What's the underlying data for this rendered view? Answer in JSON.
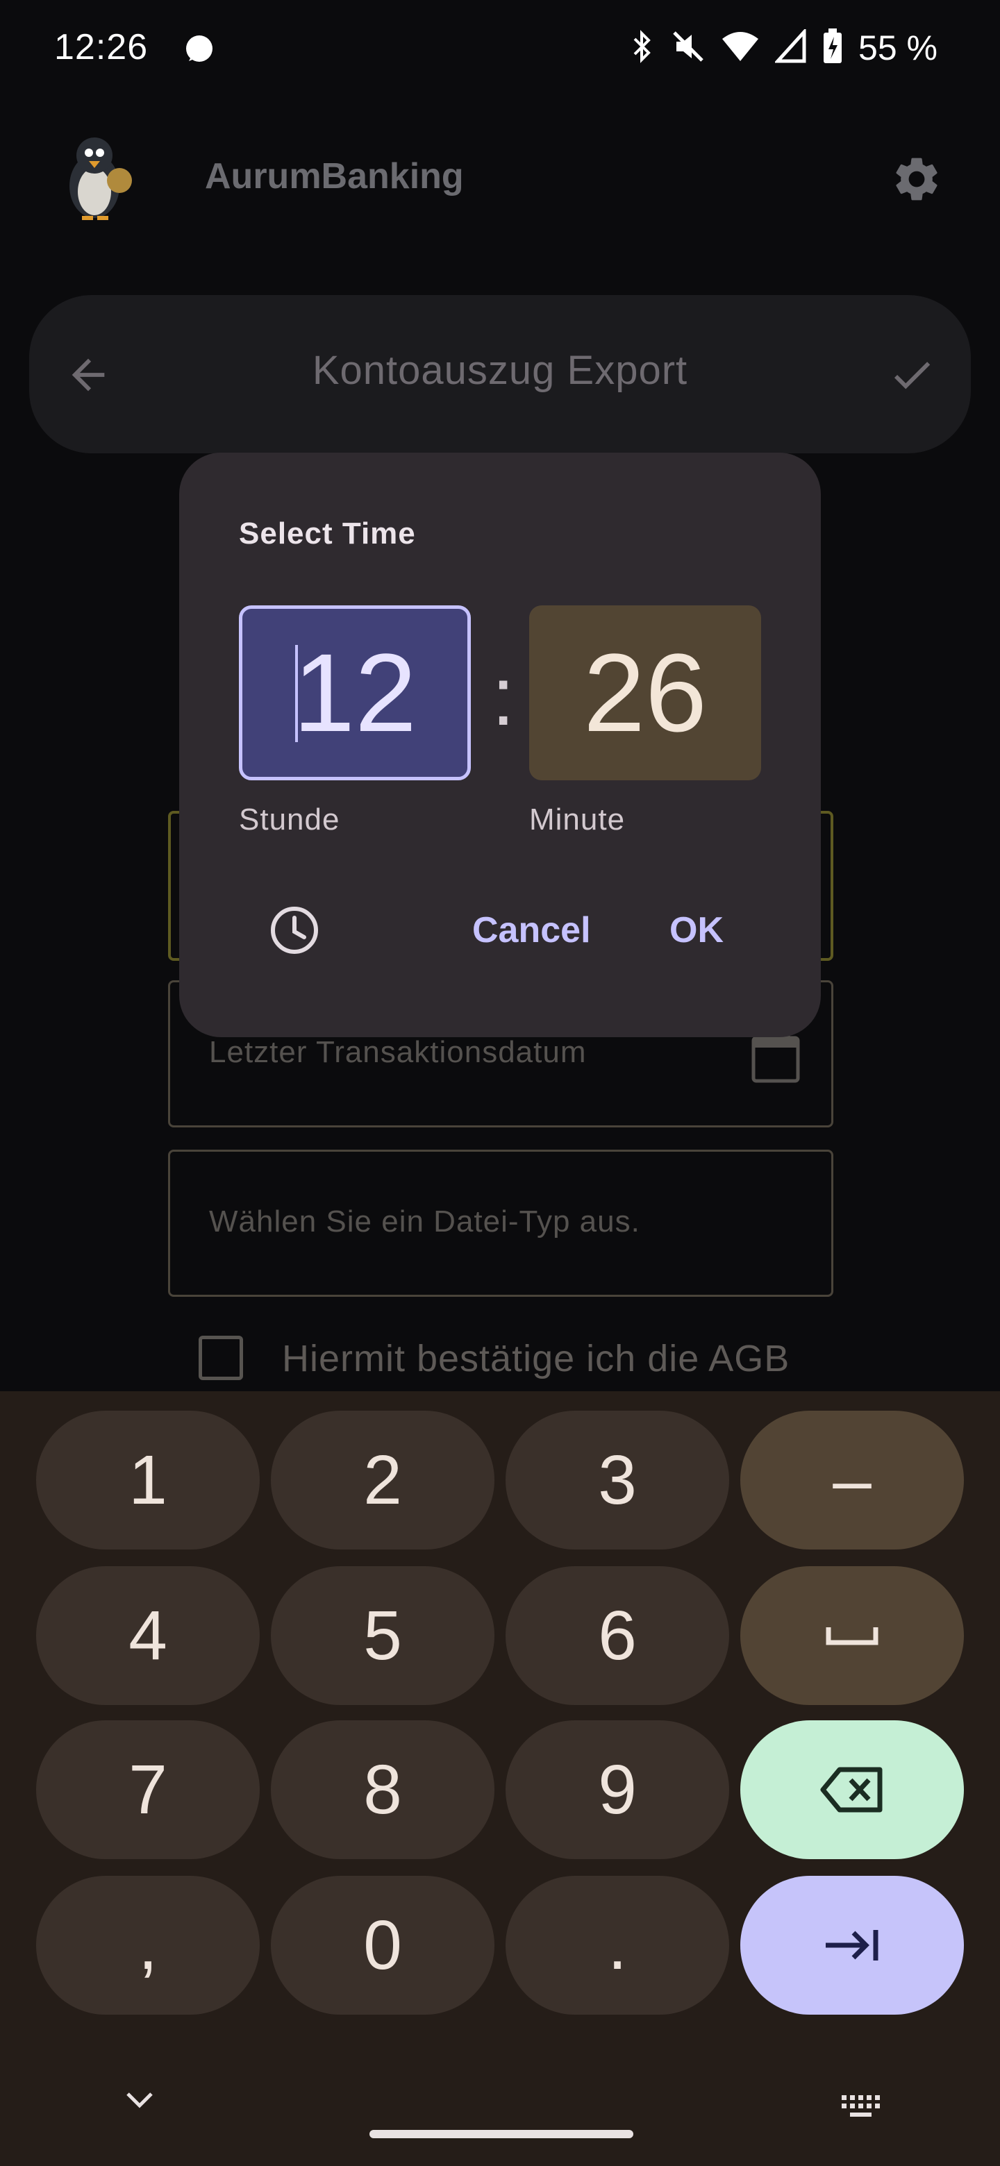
{
  "status_bar": {
    "time": "12:26",
    "battery": "55 %",
    "icons": [
      "signal-app-icon",
      "bluetooth-icon",
      "mute-icon",
      "wifi-icon",
      "cell-signal-icon",
      "battery-charging-icon"
    ]
  },
  "app_bar": {
    "title": "AurumBanking",
    "logo": "penguin-logo-icon",
    "settings": "gear-icon"
  },
  "export_header": {
    "title": "Kontoauszug Export",
    "back": "back-arrow-icon",
    "confirm": "check-icon"
  },
  "form": {
    "last_transaction_placeholder": "Letzter Transaktionsdatum",
    "file_type_placeholder": "Wählen Sie ein Datei-Typ aus.",
    "agb_label": "Hiermit bestätige ich die AGB",
    "agb_checked": false
  },
  "time_dialog": {
    "title": "Select Time",
    "hour": "12",
    "minute": "26",
    "separator": ":",
    "hour_label": "Stunde",
    "minute_label": "Minute",
    "cancel_label": "Cancel",
    "ok_label": "OK",
    "mode_icon": "clock-icon"
  },
  "keyboard": {
    "keys": [
      {
        "label": "1"
      },
      {
        "label": "2"
      },
      {
        "label": "3"
      },
      {
        "label": "–"
      },
      {
        "label": "4"
      },
      {
        "label": "5"
      },
      {
        "label": "6"
      },
      {
        "label": "␣"
      },
      {
        "label": "7"
      },
      {
        "label": "8"
      },
      {
        "label": "9"
      },
      {
        "label": "backspace"
      },
      {
        "label": ","
      },
      {
        "label": "0"
      },
      {
        "label": "."
      },
      {
        "label": "next"
      }
    ]
  },
  "colors": {
    "accent": "#c6c2ff",
    "hour_box": "#414178",
    "minute_box": "#524533",
    "backspace_key": "#c5efd5",
    "next_key": "#c6c4fa"
  }
}
